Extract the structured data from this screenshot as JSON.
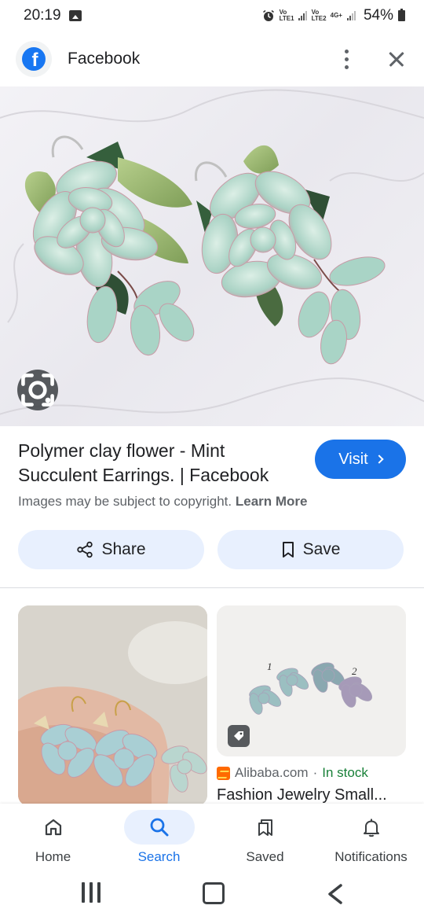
{
  "status_bar": {
    "time": "20:19",
    "battery": "54%",
    "network": "4G+",
    "sim1": "Vo LTE1",
    "sim2": "Vo LTE2",
    "icons": [
      "gallery-icon",
      "alarm-icon",
      "signal-icon",
      "battery-icon"
    ]
  },
  "header": {
    "title": "Facebook",
    "logo_icon": "facebook-logo",
    "menu_icon": "more-vert-icon",
    "close_icon": "close-icon"
  },
  "hero": {
    "lens_icon": "google-lens-icon"
  },
  "result": {
    "title": "Polymer clay flower - Mint Succulent Earrings. | Facebook",
    "visit_label": "Visit",
    "copyright_text": "Images may be subject to copyright.",
    "learn_more": "Learn More",
    "share_label": "Share",
    "save_label": "Save"
  },
  "related": [
    {
      "has_caption": false
    },
    {
      "image_labels": [
        "1",
        "2"
      ],
      "tag_icon": "tag-icon",
      "source": "Alibaba.com",
      "separator": "·",
      "availability": "In stock",
      "title": "Fashion Jewelry Small..."
    }
  ],
  "bottom_nav": {
    "items": [
      {
        "label": "Home",
        "icon": "home-icon",
        "active": false
      },
      {
        "label": "Search",
        "icon": "search-icon",
        "active": true
      },
      {
        "label": "Saved",
        "icon": "saved-icon",
        "active": false
      },
      {
        "label": "Notifications",
        "icon": "bell-icon",
        "active": false
      }
    ]
  },
  "colors": {
    "accent": "#1a73e8",
    "pill_bg": "#e8f0fe",
    "facebook_blue": "#1877f2",
    "in_stock": "#188038"
  }
}
